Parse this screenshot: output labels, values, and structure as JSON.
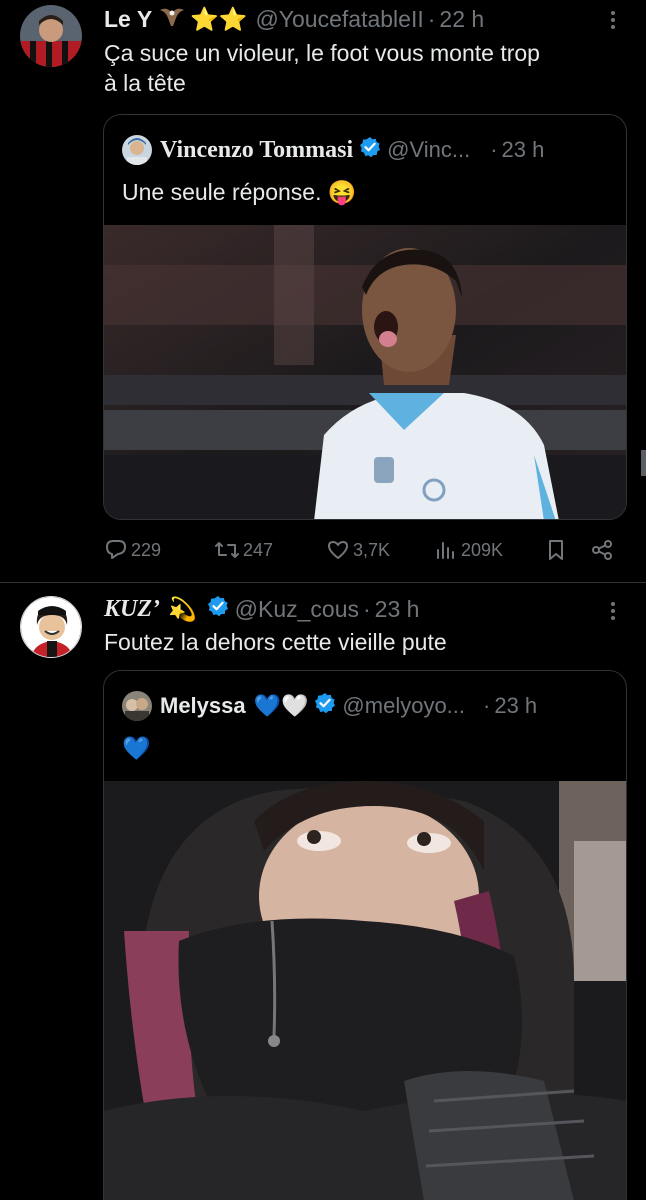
{
  "tweet1": {
    "name": "Le Y",
    "name_emoji": "⭐⭐",
    "handle": "@YoucefatableII",
    "dot": "·",
    "time": "22 h",
    "text_line1": "Ça suce un violeur, le foot vous monte trop",
    "text_line2": "à la tête",
    "quote": {
      "name": "Vincenzo Tommasi",
      "handle": "@Vinc...",
      "dot": "·",
      "time": "23 h",
      "text": "Une seule réponse. 😝"
    },
    "stats": {
      "replies": "229",
      "reposts": "247",
      "likes": "3,7K",
      "views": "209K"
    }
  },
  "tweet2": {
    "name": "KUZ’",
    "name_emoji": "💫",
    "handle": "@Kuz_cous",
    "dot": "·",
    "time": "23 h",
    "text": "Foutez la dehors cette vieille pute",
    "quote": {
      "name": "Melyssa",
      "name_emoji": "💙🤍",
      "handle": "@melyoyo...",
      "dot": "·",
      "time": "23 h",
      "text": "💙"
    }
  },
  "colors": {
    "background": "#000000",
    "text": "#e7e9ea",
    "muted": "#71767b",
    "border": "#2f3336",
    "verified": "#1d9bf0"
  }
}
